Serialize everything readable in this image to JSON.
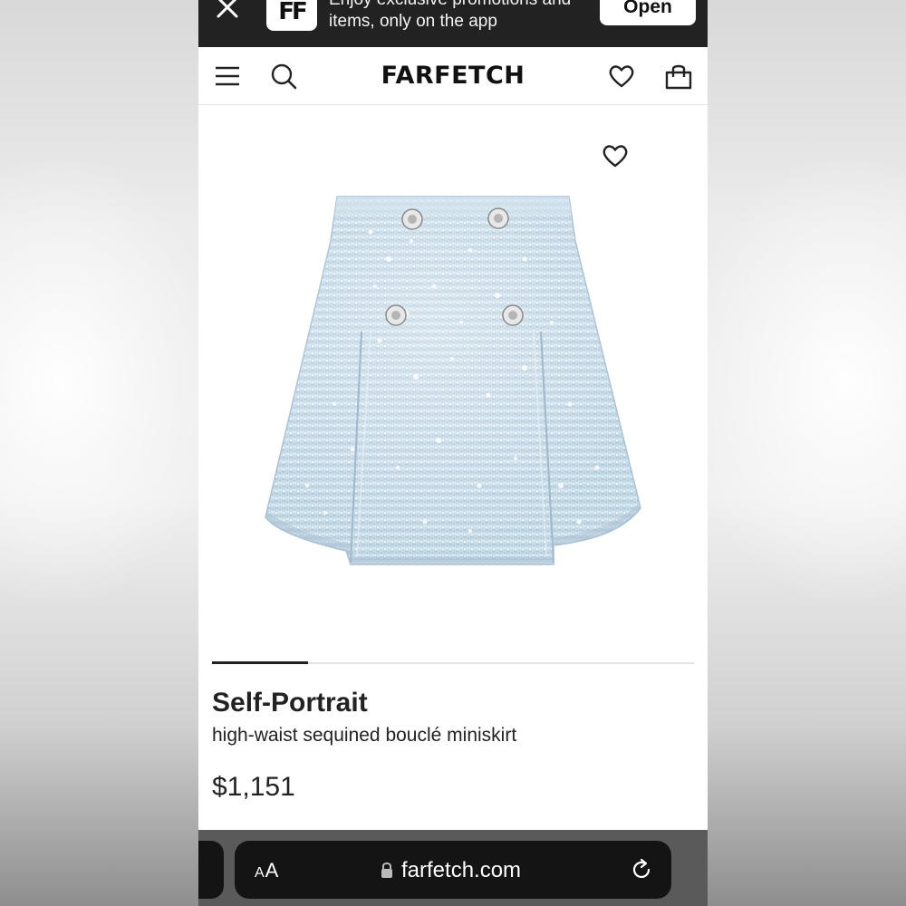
{
  "app_banner": {
    "line1": "Enjoy exclusive promotions and",
    "line2": "items, only on the app",
    "open_label": "Open",
    "logo_text": "FF"
  },
  "header": {
    "logo": "FARFETCH"
  },
  "product": {
    "brand": "Self-Portrait",
    "description": "high-waist sequined bouclé miniskirt",
    "price": "$1,151",
    "image_color": "#c9dde9",
    "carousel_progress": 0.2
  },
  "browser": {
    "text_size_label_small": "A",
    "text_size_label_large": "A",
    "url": "farfetch.com"
  }
}
